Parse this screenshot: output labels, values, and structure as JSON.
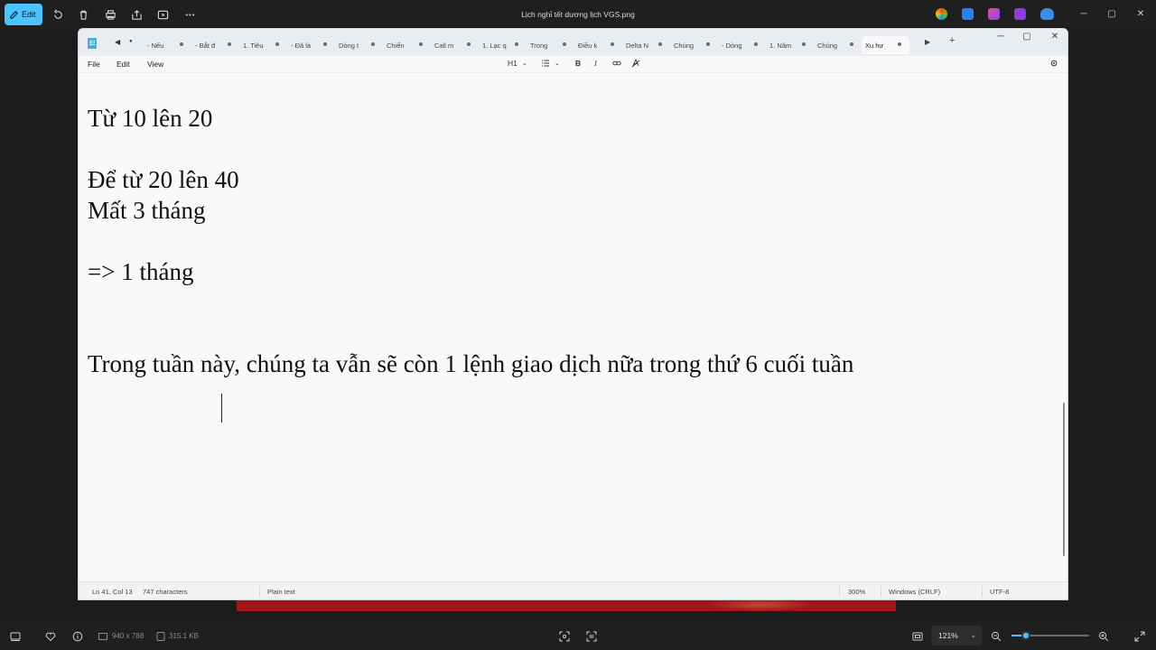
{
  "photos": {
    "edit_label": "Edit",
    "title": "Lịch nghỉ tết dương lịch VGS.png",
    "image_dimensions": "940 x 788",
    "file_size": "315.1 KB",
    "zoom": "121%",
    "zoom_level_fraction": 0.19
  },
  "notepad": {
    "tabs": [
      "- Nếu",
      "- Bắt đ",
      "1. Tiêu",
      "- Đã là",
      "Dòng t",
      "Chiến",
      "Call m",
      "1. Lạc q",
      "Trong",
      "Điều k",
      "Delta N",
      "Chúng",
      "- Dòng",
      "1. Năm",
      "Chúng",
      "Xu hư"
    ],
    "active_tab_index": 15,
    "menu": {
      "file": "File",
      "edit": "Edit",
      "view": "View"
    },
    "format": {
      "heading": "H1",
      "bold": "B",
      "italic": "I"
    },
    "lines": {
      "l1": "Từ 10 lên 20",
      "l2": "Để từ 20 lên 40",
      "l3": "Mất 3 tháng",
      "l4": "=> 1 tháng",
      "l5": "Trong tuần này, chúng ta vẫn sẽ còn 1 lệnh giao dịch nữa trong thứ 6 cuối tuần"
    },
    "status": {
      "position": "Ln 41, Col 13",
      "characters": "747 characters",
      "mode": "Plain text",
      "zoom": "300%",
      "line_ending": "Windows (CRLF)",
      "encoding": "UTF-8"
    }
  }
}
